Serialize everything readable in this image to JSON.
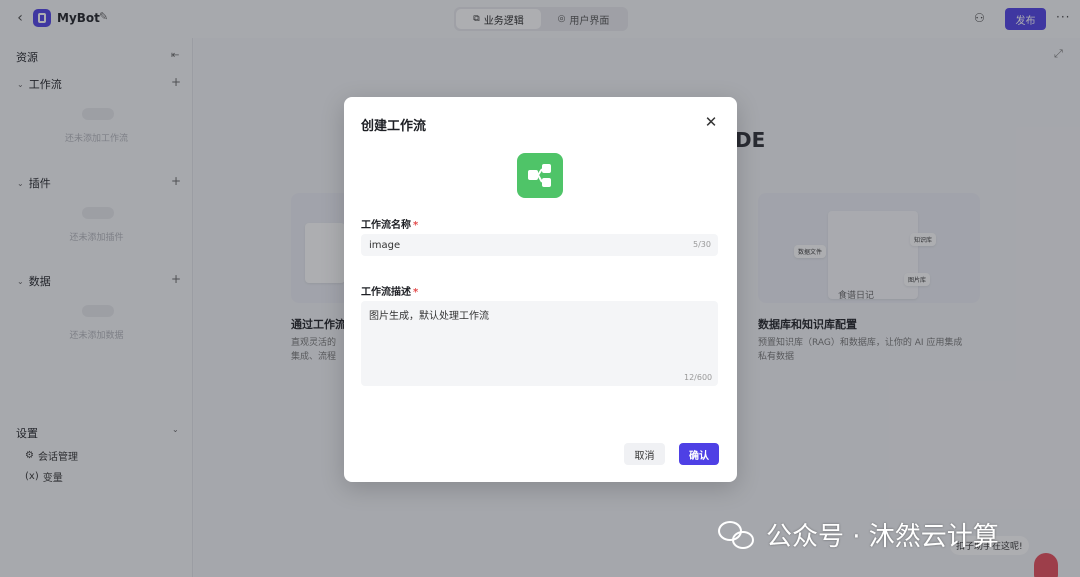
{
  "topbar": {
    "bot_name": "MyBot",
    "tabs": [
      {
        "label": "业务逻辑",
        "icon": "flow-icon",
        "active": true
      },
      {
        "label": "用户界面",
        "icon": "palette-icon",
        "active": false
      }
    ],
    "publish_label": "发布"
  },
  "sidebar": {
    "heading": "资源",
    "sections": [
      {
        "title": "工作流",
        "empty_text": "还未添加工作流"
      },
      {
        "title": "插件",
        "empty_text": "还未添加插件"
      },
      {
        "title": "数据",
        "empty_text": "还未添加数据"
      }
    ],
    "settings": {
      "title": "设置",
      "items": [
        {
          "label": "会话管理",
          "icon": "chat-settings-icon"
        },
        {
          "label": "变量",
          "icon": "variable-icon",
          "prefix": "(x)"
        }
      ]
    }
  },
  "background": {
    "heading_fragment": "DE",
    "card_left": {
      "title": "通过工作流",
      "desc_line1": "直观灵活的",
      "desc_line2": "集成、流程"
    },
    "card_right": {
      "title": "数据库和知识库配置",
      "desc_line1": "预置知识库（RAG）和数据库，让你的 AI 应用集成",
      "desc_line2": "私有数据",
      "mini_labels": [
        "数据文件",
        "知识库",
        "图片库",
        "食谱日记"
      ]
    },
    "help_text": "扣子助手在这呢!",
    "watermark_text": "公众号 · 沐然云计算"
  },
  "modal": {
    "title": "创建工作流",
    "name_label": "工作流名称",
    "name_value": "image",
    "name_count": "5/30",
    "desc_label": "工作流描述",
    "desc_value": "图片生成，默认处理工作流",
    "desc_count": "12/600",
    "required_mark": "*",
    "cancel_label": "取消",
    "confirm_label": "确认"
  },
  "colors": {
    "accent": "#4e40e5",
    "workflow_icon_bg": "#4fc468",
    "required": "#e34d4d"
  }
}
